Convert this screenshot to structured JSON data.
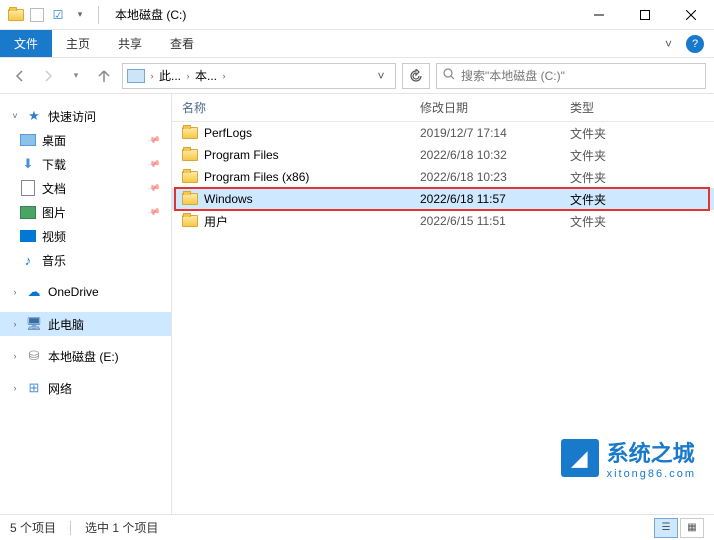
{
  "window": {
    "title": "本地磁盘 (C:)"
  },
  "ribbon": {
    "file": "文件",
    "home": "主页",
    "share": "共享",
    "view": "查看"
  },
  "address": {
    "seg1": "此...",
    "seg2": "本...",
    "refresh_tip": "刷新"
  },
  "search": {
    "placeholder": "搜索\"本地磁盘 (C:)\""
  },
  "sidebar": {
    "quick_access": "快速访问",
    "desktop": "桌面",
    "downloads": "下载",
    "documents": "文档",
    "pictures": "图片",
    "videos": "视频",
    "music": "音乐",
    "onedrive": "OneDrive",
    "this_pc": "此电脑",
    "local_disk": "本地磁盘 (E:)",
    "network": "网络"
  },
  "columns": {
    "name": "名称",
    "modified": "修改日期",
    "type": "类型"
  },
  "rows": [
    {
      "name": "PerfLogs",
      "date": "2019/12/7 17:14",
      "type": "文件夹",
      "selected": false
    },
    {
      "name": "Program Files",
      "date": "2022/6/18 10:32",
      "type": "文件夹",
      "selected": false
    },
    {
      "name": "Program Files (x86)",
      "date": "2022/6/18 10:23",
      "type": "文件夹",
      "selected": false
    },
    {
      "name": "Windows",
      "date": "2022/6/18 11:57",
      "type": "文件夹",
      "selected": true
    },
    {
      "name": "用户",
      "date": "2022/6/15 11:51",
      "type": "文件夹",
      "selected": false
    }
  ],
  "status": {
    "item_count": "5 个项目",
    "selection": "选中 1 个项目"
  },
  "watermark": {
    "main": "系统之城",
    "sub": "xitong86.com"
  }
}
